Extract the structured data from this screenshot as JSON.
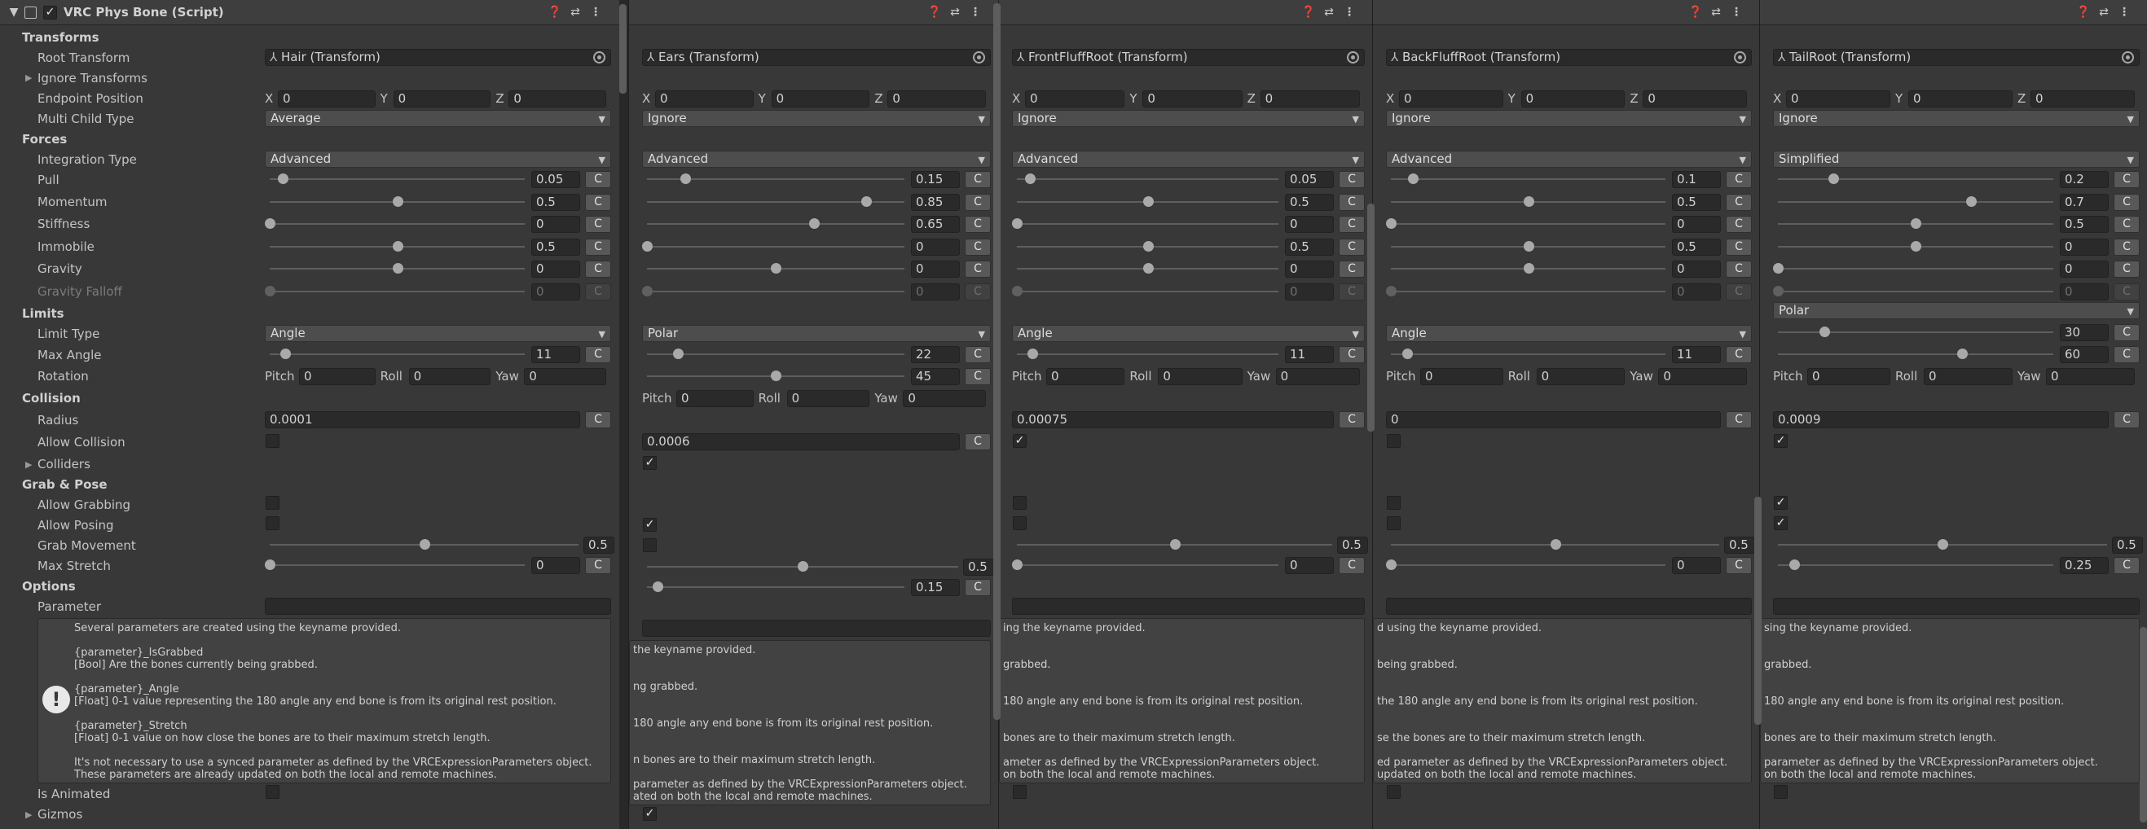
{
  "component": {
    "title": "VRC Phys Bone (Script)",
    "enabled": true,
    "icon_names": [
      "book-icon",
      "settings-sliders-icon",
      "more-vert-icon"
    ]
  },
  "labels": {
    "transforms": "Transforms",
    "root_transform": "Root Transform",
    "ignore_transforms": "Ignore Transforms",
    "endpoint_position": "Endpoint Position",
    "multi_child_type": "Multi Child Type",
    "forces": "Forces",
    "integration_type": "Integration Type",
    "pull": "Pull",
    "momentum": "Momentum",
    "stiffness": "Stiffness",
    "immobile": "Immobile",
    "gravity": "Gravity",
    "gravity_falloff": "Gravity Falloff",
    "limits": "Limits",
    "limit_type": "Limit Type",
    "max_angle": "Max Angle",
    "rotation": "Rotation",
    "collision": "Collision",
    "radius": "Radius",
    "allow_collision": "Allow Collision",
    "colliders": "Colliders",
    "grab_pose": "Grab & Pose",
    "allow_grabbing": "Allow Grabbing",
    "allow_posing": "Allow Posing",
    "grab_movement": "Grab Movement",
    "max_stretch": "Max Stretch",
    "options": "Options",
    "parameter": "Parameter",
    "is_animated": "Is Animated",
    "gizmos": "Gizmos",
    "x": "X",
    "y": "Y",
    "z": "Z",
    "pitch": "Pitch",
    "roll": "Roll",
    "yaw": "Yaw",
    "c": "C"
  },
  "help_lines": [
    "Several parameters are created using the keyname provided.",
    "",
    "{parameter}_IsGrabbed",
    " [Bool] Are the bones currently being grabbed.",
    "",
    "{parameter}_Angle",
    " [Float] 0-1 value representing the 180 angle any end bone is from its original rest position.",
    "",
    "{parameter}_Stretch",
    " [Float] 0-1 value on how close the bones are to their maximum stretch length.",
    "",
    "It's not necessary to use a synced parameter as defined by the VRCExpressionParameters object.",
    "These parameters are already updated on both the local and remote machines."
  ],
  "help_fragments": {
    "ears": [
      "the keyname provided.",
      "",
      "",
      "ng grabbed.",
      "",
      "",
      "180 angle any end bone is from its original rest position.",
      "",
      "",
      "n bones are to their maximum stretch length.",
      "",
      "parameter as defined by the VRCExpressionParameters object.",
      "ated on both the local and remote machines."
    ],
    "front": [
      "ing the keyname provided.",
      "",
      "",
      "grabbed.",
      "",
      "",
      "180 angle any end bone is from its original rest position.",
      "",
      "",
      "bones are to their maximum stretch length.",
      "",
      "ameter as defined by the VRCExpressionParameters object.",
      "on both the local and remote machines."
    ],
    "back": [
      "d using the keyname provided.",
      "",
      "",
      "being grabbed.",
      "",
      "",
      "the 180 angle any end bone is from its original rest position.",
      "",
      "",
      "se the bones are to their maximum stretch length.",
      "",
      "ed parameter as defined by the VRCExpressionParameters object.",
      "updated on both the local and remote machines."
    ],
    "tail": [
      "sing the keyname provided.",
      "",
      "",
      "grabbed.",
      "",
      "",
      "180 angle any end bone is from its original rest position.",
      "",
      "",
      "bones are to their maximum stretch length.",
      "",
      "parameter as defined by the VRCExpressionParameters object.",
      "on both the local and remote machines."
    ]
  },
  "bones": [
    {
      "root_transform": "Hair (Transform)",
      "endpoint": {
        "x": "0",
        "y": "0",
        "z": "0"
      },
      "multi_child_type": "Average",
      "integration_type": "Advanced",
      "pull": {
        "text": "0.05",
        "value": 0.05
      },
      "momentum": {
        "text": "0.5",
        "value": 0.5
      },
      "stiffness": {
        "text": "0",
        "value": 0
      },
      "immobile": {
        "text": "0.5",
        "value": 0.5
      },
      "gravity": {
        "text": "0",
        "value": 0.5
      },
      "gravity_falloff": {
        "text": "0",
        "value": 0
      },
      "limit_type": "Angle",
      "max_angle": {
        "text": "11",
        "value": 0.06
      },
      "rotation": {
        "pitch": "0",
        "roll": "0",
        "yaw": "0"
      },
      "radius": "0.0001",
      "allow_collision": false,
      "allow_grabbing": false,
      "allow_posing": false,
      "grab_movement": {
        "text": "0.5",
        "value": 0.5
      },
      "max_stretch": {
        "text": "0",
        "value": 0
      },
      "is_animated": false
    },
    {
      "root_transform": "Ears (Transform)",
      "endpoint": {
        "x": "0",
        "y": "0",
        "z": "0"
      },
      "multi_child_type": "Ignore",
      "integration_type": "Advanced",
      "pull": {
        "text": "0.15",
        "value": 0.15
      },
      "momentum": {
        "text": "0.85",
        "value": 0.85
      },
      "stiffness": {
        "text": "0.65",
        "value": 0.65
      },
      "immobile": {
        "text": "0",
        "value": 0
      },
      "gravity": {
        "text": "0",
        "value": 0.5
      },
      "gravity_falloff": {
        "text": "0",
        "value": 0
      },
      "limit_type": "Polar",
      "max_angle": {
        "text": "22",
        "value": 0.12
      },
      "max_yaw": {
        "text": "45",
        "value": 0.5
      },
      "rotation": {
        "pitch": "0",
        "roll": "0",
        "yaw": "0"
      },
      "radius": "0.0006",
      "allow_collision": true,
      "allow_grabbing": true,
      "allow_posing": false,
      "grab_movement": {
        "text": "0.5",
        "value": 0.5
      },
      "max_stretch": {
        "text": "0.15",
        "value": 0.04
      },
      "is_animated": true
    },
    {
      "root_transform": "FrontFluffRoot (Transform)",
      "endpoint": {
        "x": "0",
        "y": "0",
        "z": "0"
      },
      "multi_child_type": "Ignore",
      "integration_type": "Advanced",
      "pull": {
        "text": "0.05",
        "value": 0.05
      },
      "momentum": {
        "text": "0.5",
        "value": 0.5
      },
      "stiffness": {
        "text": "0",
        "value": 0
      },
      "immobile": {
        "text": "0.5",
        "value": 0.5
      },
      "gravity": {
        "text": "0",
        "value": 0.5
      },
      "gravity_falloff": {
        "text": "0",
        "value": 0
      },
      "limit_type": "Angle",
      "max_angle": {
        "text": "11",
        "value": 0.06
      },
      "rotation": {
        "pitch": "0",
        "roll": "0",
        "yaw": "0"
      },
      "radius": "0.00075",
      "allow_collision": true,
      "allow_grabbing": false,
      "allow_posing": false,
      "grab_movement": {
        "text": "0.5",
        "value": 0.5
      },
      "max_stretch": {
        "text": "0",
        "value": 0
      },
      "is_animated": false
    },
    {
      "root_transform": "BackFluffRoot (Transform)",
      "endpoint": {
        "x": "0",
        "y": "0",
        "z": "0"
      },
      "multi_child_type": "Ignore",
      "integration_type": "Advanced",
      "pull": {
        "text": "0.1",
        "value": 0.08
      },
      "momentum": {
        "text": "0.5",
        "value": 0.5
      },
      "stiffness": {
        "text": "0",
        "value": 0
      },
      "immobile": {
        "text": "0.5",
        "value": 0.5
      },
      "gravity": {
        "text": "0",
        "value": 0.5
      },
      "gravity_falloff": {
        "text": "0",
        "value": 0
      },
      "limit_type": "Angle",
      "max_angle": {
        "text": "11",
        "value": 0.06
      },
      "rotation": {
        "pitch": "0",
        "roll": "0",
        "yaw": "0"
      },
      "radius": "0",
      "allow_collision": false,
      "allow_grabbing": false,
      "allow_posing": false,
      "grab_movement": {
        "text": "0.5",
        "value": 0.5
      },
      "max_stretch": {
        "text": "0",
        "value": 0
      },
      "is_animated": false
    },
    {
      "root_transform": "TailRoot (Transform)",
      "endpoint": {
        "x": "0",
        "y": "0",
        "z": "0"
      },
      "multi_child_type": "Ignore",
      "integration_type": "Simplified",
      "pull": {
        "text": "0.2",
        "value": 0.2
      },
      "momentum": {
        "text": "0.7",
        "value": 0.7
      },
      "stiffness": {
        "text": "0.5",
        "value": 0.5
      },
      "immobile": {
        "text": "0",
        "value": 0.5
      },
      "gravity": {
        "text": "0",
        "value": 0
      },
      "gravity_falloff": {
        "text": "0",
        "value": 0
      },
      "limit_type": "Polar",
      "max_angle": {
        "text": "30",
        "value": 0.17
      },
      "max_yaw": {
        "text": "60",
        "value": 0.67
      },
      "rotation": {
        "pitch": "0",
        "roll": "0",
        "yaw": "0"
      },
      "radius": "0.0009",
      "allow_collision": true,
      "allow_grabbing": true,
      "allow_posing": true,
      "grab_movement": {
        "text": "0.5",
        "value": 0.5
      },
      "max_stretch": {
        "text": "0.25",
        "value": 0.06
      },
      "is_animated": false
    }
  ]
}
